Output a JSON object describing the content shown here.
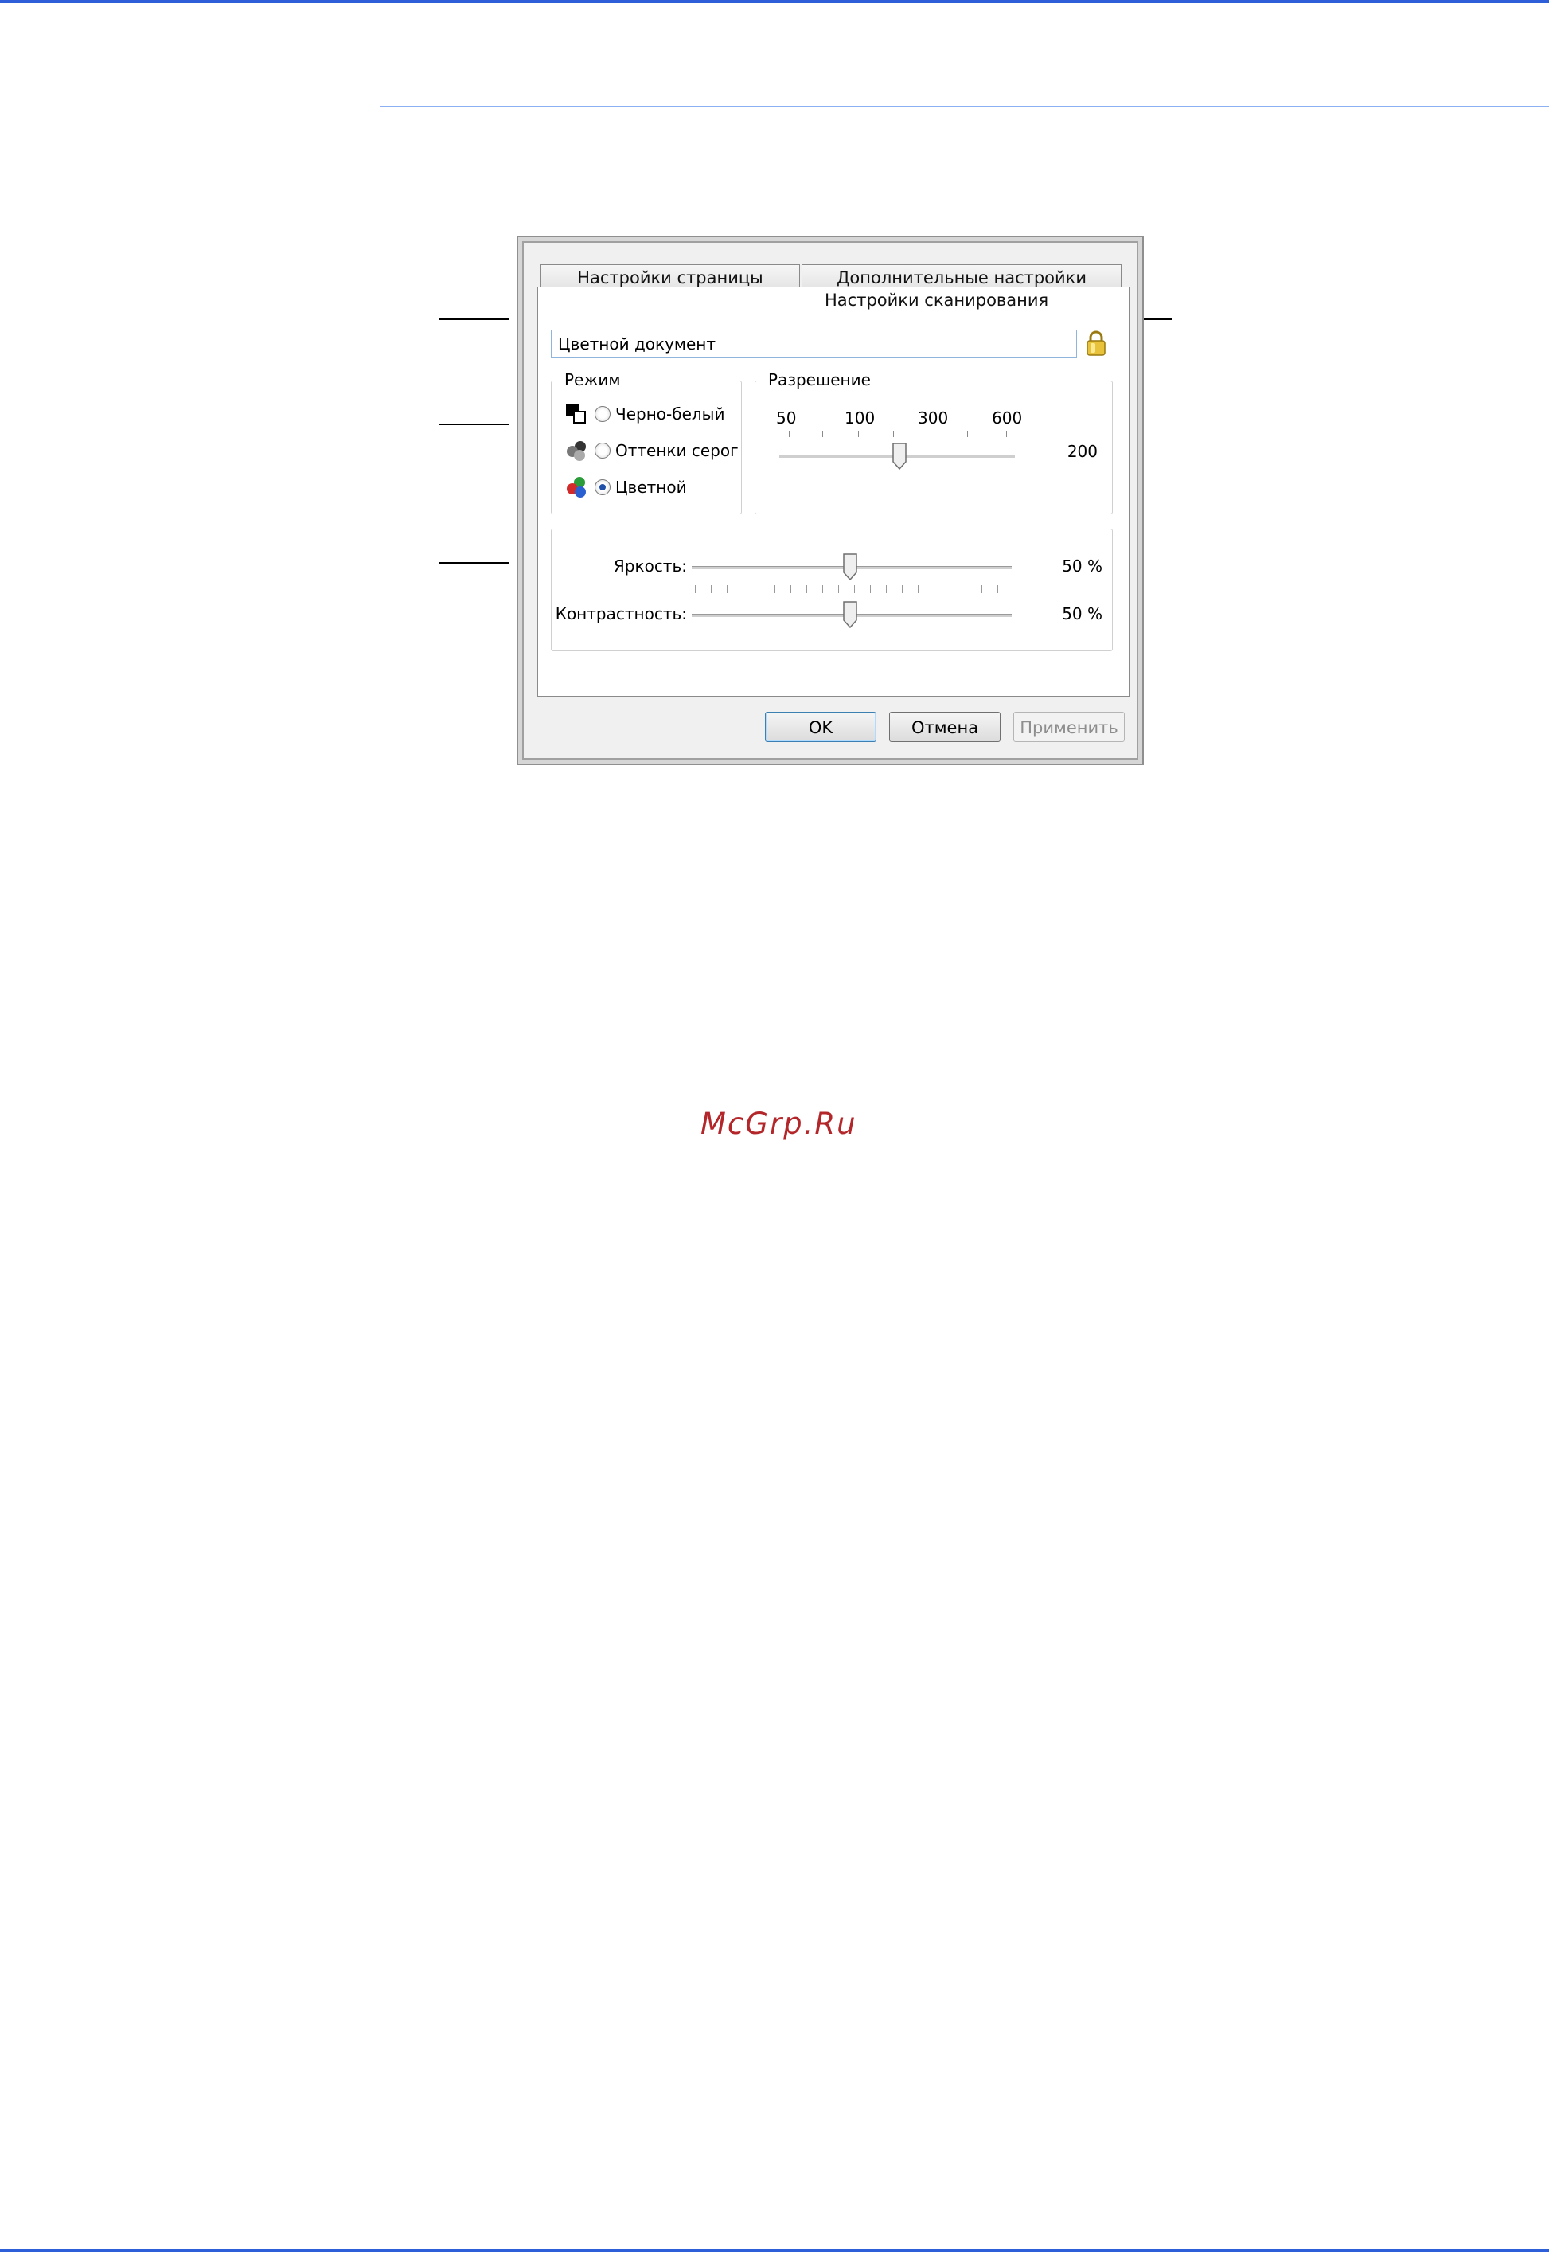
{
  "dialog": {
    "tabs": {
      "page_settings": "Настройки страницы",
      "advanced_settings": "Дополнительные настройки",
      "scan_settings": "Настройки сканирования"
    },
    "preset_value": "Цветной документ",
    "mode": {
      "title": "Режим",
      "options": [
        {
          "label": "Черно-белый",
          "checked": false,
          "icon": "bw-mode-icon"
        },
        {
          "label": "Оттенки серог",
          "checked": false,
          "icon": "grayscale-mode-icon"
        },
        {
          "label": "Цветной",
          "checked": true,
          "icon": "color-mode-icon"
        }
      ]
    },
    "resolution": {
      "title": "Разрешение",
      "ticks": [
        "50",
        "100",
        "300",
        "600"
      ],
      "value": "200"
    },
    "adjustments": {
      "brightness_label": "Яркость:",
      "brightness_value": "50 %",
      "contrast_label": "Контрастность:",
      "contrast_value": "50 %"
    },
    "buttons": {
      "ok": "OK",
      "cancel": "Отмена",
      "apply": "Применить"
    }
  },
  "watermark": "McGrp.Ru",
  "colors": {
    "accent_blue": "#2f5fd8",
    "header_rule": "#8cb0f2",
    "watermark": "#b3262a"
  }
}
